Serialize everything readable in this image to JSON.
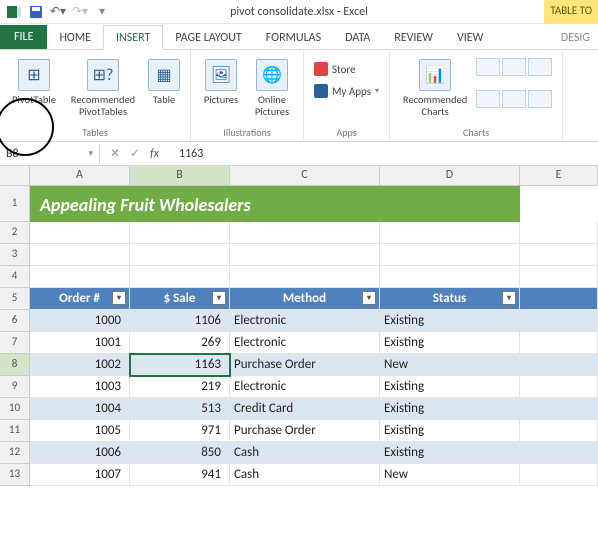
{
  "titlebar": {
    "title": "pivot consolidate.xlsx - Excel",
    "context_tool": "TABLE TO"
  },
  "tabs": {
    "file": "FILE",
    "home": "HOME",
    "insert": "INSERT",
    "page_layout": "PAGE LAYOUT",
    "formulas": "FORMULAS",
    "data": "DATA",
    "review": "REVIEW",
    "view": "VIEW",
    "design": "DESIG"
  },
  "ribbon": {
    "tables": {
      "pivottable": "PivotTable",
      "recommended": "Recommended\nPivotTables",
      "table": "Table",
      "group": "Tables"
    },
    "illustrations": {
      "pictures": "Pictures",
      "online_pictures": "Online\nPictures",
      "group": "Illustrations"
    },
    "apps": {
      "store": "Store",
      "myapps": "My Apps",
      "group": "Apps"
    },
    "charts": {
      "recommended": "Recommended\nCharts",
      "group": "Charts"
    }
  },
  "namebox": {
    "ref": "B8",
    "formula": "1163"
  },
  "columns": [
    "A",
    "B",
    "C",
    "D",
    "E"
  ],
  "banner": "Appealing Fruit Wholesalers",
  "headers": {
    "order": "Order #",
    "sale": "$ Sale",
    "method": "Method",
    "status": "Status"
  },
  "chart_data": {
    "type": "table",
    "columns": [
      "Order #",
      "$ Sale",
      "Method",
      "Status"
    ],
    "rows": [
      {
        "row": 6,
        "order": "1000",
        "sale": "1106",
        "method": "Electronic",
        "status": "Existing"
      },
      {
        "row": 7,
        "order": "1001",
        "sale": "269",
        "method": "Electronic",
        "status": "Existing"
      },
      {
        "row": 8,
        "order": "1002",
        "sale": "1163",
        "method": "Purchase Order",
        "status": "New"
      },
      {
        "row": 9,
        "order": "1003",
        "sale": "219",
        "method": "Electronic",
        "status": "Existing"
      },
      {
        "row": 10,
        "order": "1004",
        "sale": "513",
        "method": "Credit Card",
        "status": "Existing"
      },
      {
        "row": 11,
        "order": "1005",
        "sale": "971",
        "method": "Purchase Order",
        "status": "Existing"
      },
      {
        "row": 12,
        "order": "1006",
        "sale": "850",
        "method": "Cash",
        "status": "Existing"
      },
      {
        "row": 13,
        "order": "1007",
        "sale": "941",
        "method": "Cash",
        "status": "New"
      }
    ]
  },
  "selected": {
    "row": 8,
    "col": "B"
  }
}
